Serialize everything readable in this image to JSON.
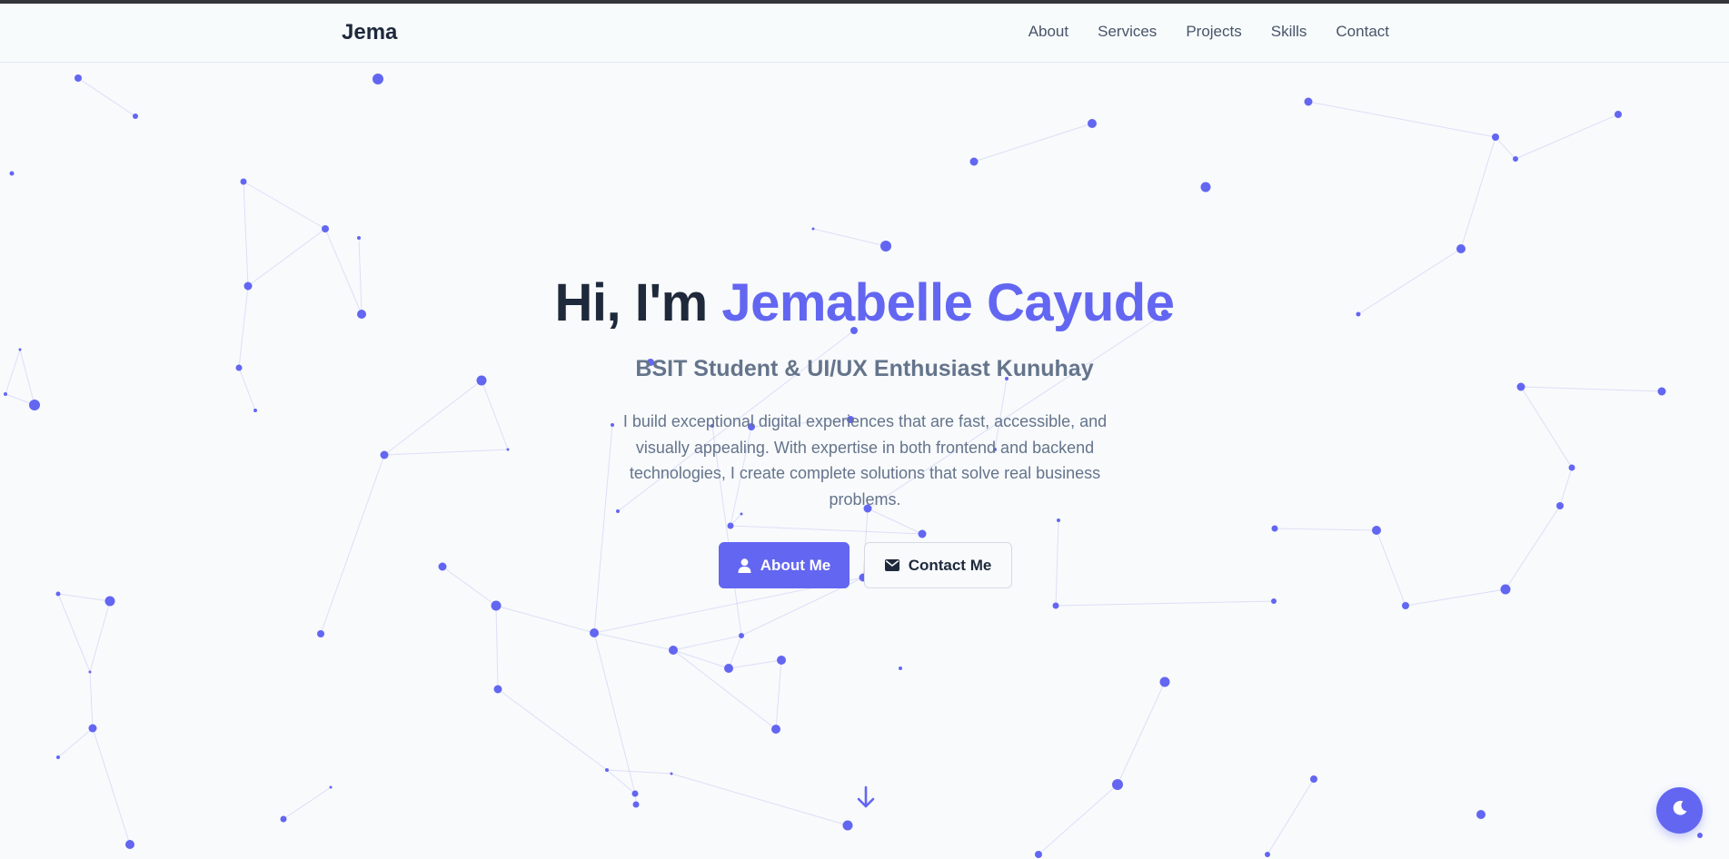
{
  "nav": {
    "logo": "Jema",
    "links": [
      "About",
      "Services",
      "Projects",
      "Skills",
      "Contact"
    ]
  },
  "hero": {
    "greeting": "Hi, I'm ",
    "name": "Jemabelle Cayude",
    "subtitle": "BSIT Student & UI/UX Enthusiast Kunuhay",
    "description": "I build exceptional digital experiences that are fast, accessible, and visually appealing. With expertise in both frontend and backend technologies, I create complete solutions that solve real business problems.",
    "primary_button": "About Me",
    "primary_button_icon": "user-icon",
    "secondary_button": "Contact Me",
    "secondary_button_icon": "envelope-icon"
  },
  "scroll_icon": "arrow-down-icon",
  "theme_toggle_icon": "moon-icon",
  "colors": {
    "accent": "#6366f1",
    "heading": "#1e293b",
    "muted": "#64748b",
    "background": "#f8fafc"
  }
}
